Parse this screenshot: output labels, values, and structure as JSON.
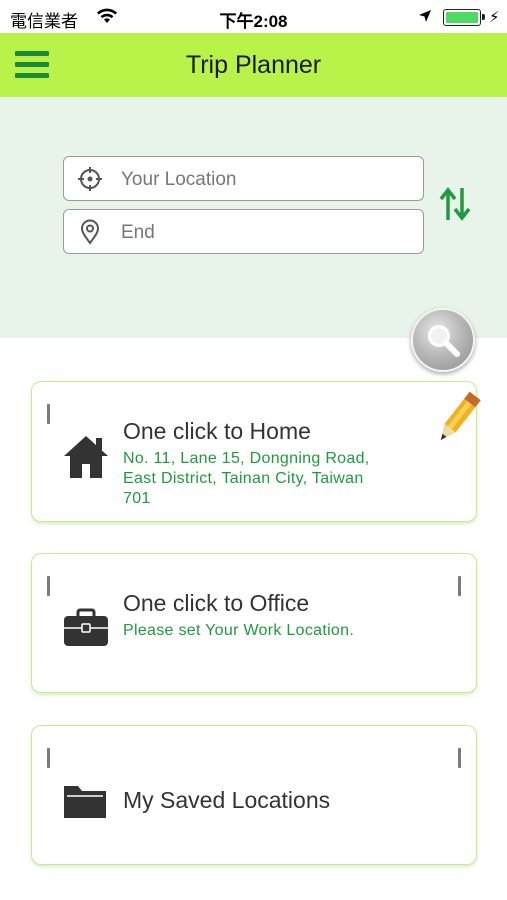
{
  "status_bar": {
    "carrier": "電信業者",
    "time": "下午2:08"
  },
  "header": {
    "title": "Trip Planner"
  },
  "search": {
    "start_placeholder": "Your Location",
    "end_placeholder": "End"
  },
  "cards": {
    "home": {
      "title": "One click to Home",
      "address_line1": "No. 11, Lane 15, Dongning Road,",
      "address_line2": "East District, Tainan City, Taiwan",
      "address_line3": "701"
    },
    "office": {
      "title": "One click to Office",
      "subtitle": "Please set Your Work Location."
    },
    "saved": {
      "title": "My Saved Locations"
    }
  },
  "colors": {
    "header_bg": "#b9f34a",
    "panel_bg": "#e8f4ea",
    "accent_green": "#1f9a3f"
  },
  "icons": {
    "menu": "hamburger-icon",
    "start": "crosshair-icon",
    "end": "location-pin-icon",
    "swap": "swap-arrows-icon",
    "search": "magnifier-icon",
    "home": "house-icon",
    "office": "briefcase-icon",
    "saved": "folder-icon",
    "edit": "pencil-icon"
  }
}
